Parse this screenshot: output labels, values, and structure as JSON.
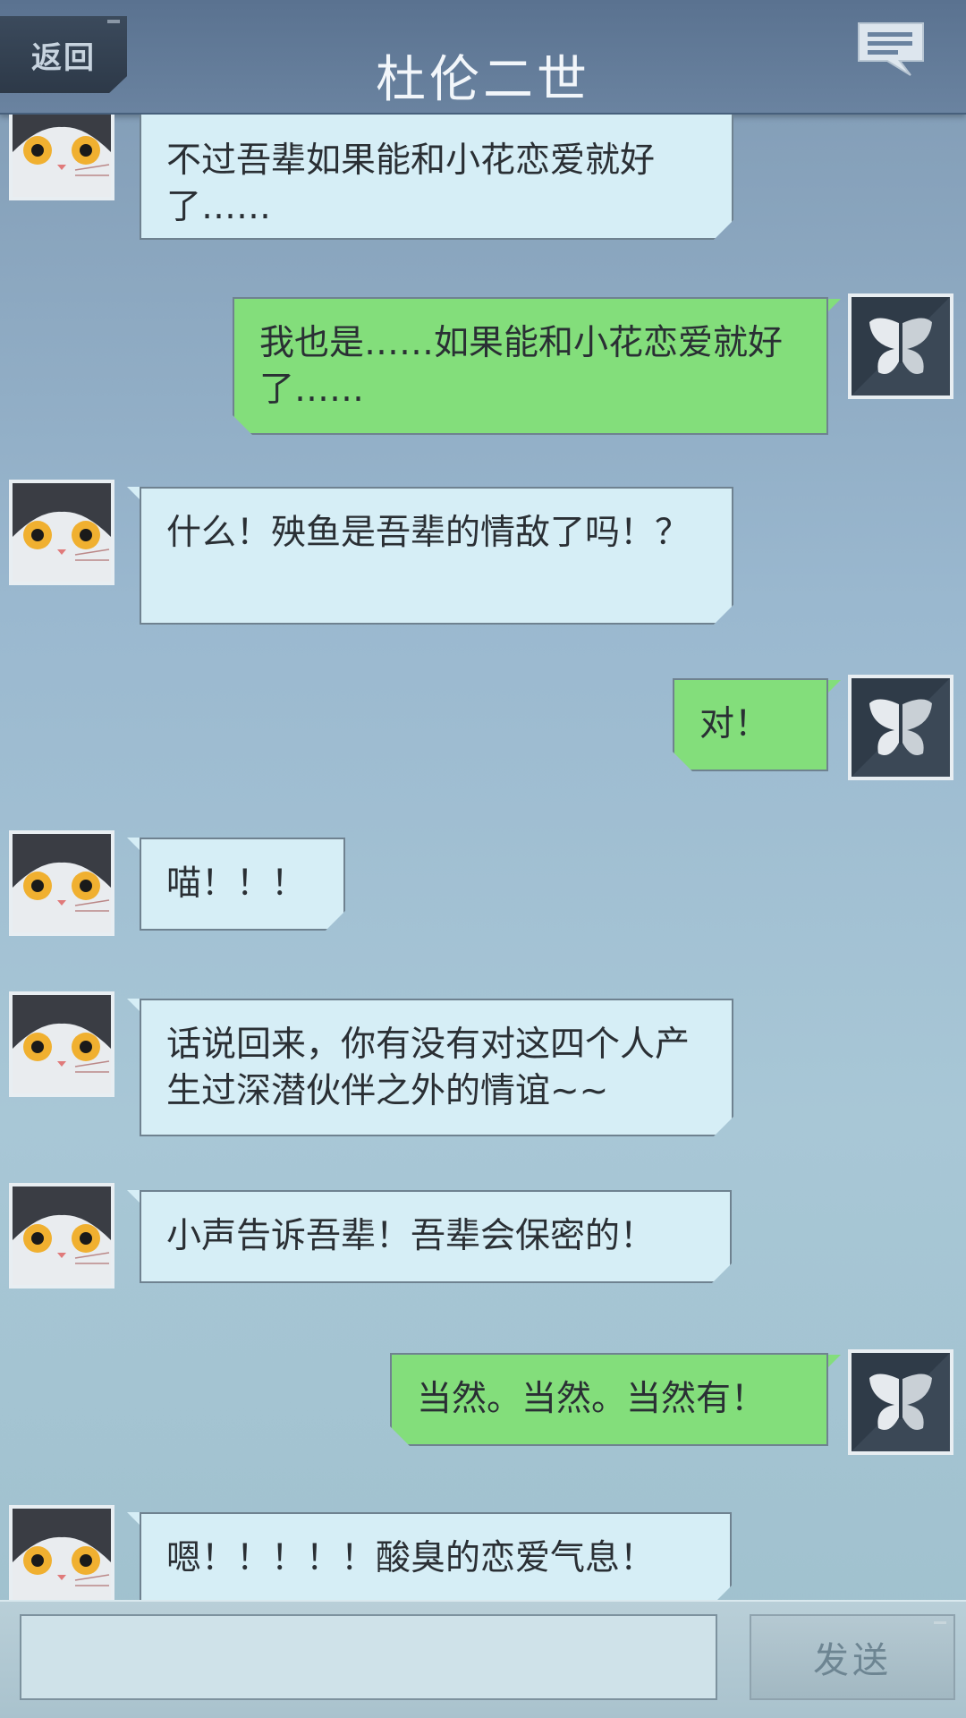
{
  "header": {
    "back_label": "返回",
    "title": "杜伦二世",
    "chat_icon": "speech-bubble-icon"
  },
  "avatars": {
    "cat": "cat-avatar",
    "butterfly": "butterfly-avatar"
  },
  "messages": [
    {
      "side": "left",
      "text": "不过吾辈如果能和小花恋爱就好了……"
    },
    {
      "side": "right",
      "text": "我也是……如果能和小花恋爱就好了……"
    },
    {
      "side": "left",
      "text": "什么！殃鱼是吾辈的情敌了吗！？"
    },
    {
      "side": "right",
      "text": "对！"
    },
    {
      "side": "left",
      "text": "喵！！！"
    },
    {
      "side": "left",
      "text": "话说回来，你有没有对这四个人产生过深潜伙伴之外的情谊~~"
    },
    {
      "side": "left",
      "text": "小声告诉吾辈！吾辈会保密的！"
    },
    {
      "side": "right",
      "text": "当然。当然。当然有！"
    },
    {
      "side": "left",
      "text": "嗯！！！！！酸臭的恋爱气息！"
    }
  ],
  "input": {
    "value": "",
    "placeholder": ""
  },
  "send_label": "发送"
}
